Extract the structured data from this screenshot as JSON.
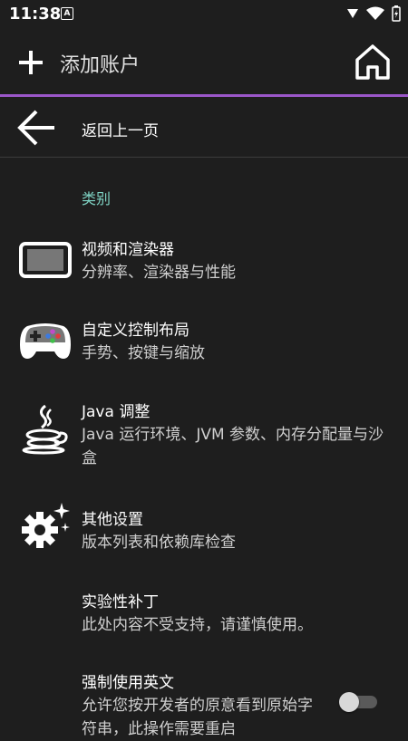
{
  "status_bar": {
    "time": "11:38",
    "notification_badge": "A"
  },
  "app_bar": {
    "title": "添加账户"
  },
  "back": {
    "label": "返回上一页"
  },
  "category": "类别",
  "items": [
    {
      "title": "视频和渲染器",
      "subtitle": "分辨率、渲染器与性能",
      "icon": "display-icon"
    },
    {
      "title": "自定义控制布局",
      "subtitle": "手势、按键与缩放",
      "icon": "gamepad-icon"
    },
    {
      "title": "Java 调整",
      "subtitle": "Java 运行环境、JVM 参数、内存分配量与沙盒",
      "icon": "java-icon"
    },
    {
      "title": "其他设置",
      "subtitle": "版本列表和依赖库检查",
      "icon": "gear-sparkle-icon"
    },
    {
      "title": "实验性补丁",
      "subtitle": "此处内容不受支持，请谨慎使用。",
      "icon": ""
    },
    {
      "title": "强制使用英文",
      "subtitle": "允许您按开发者的原意看到原始字符串，此操作需要重启",
      "icon": ""
    }
  ],
  "force_english_toggle": {
    "on": false
  },
  "colors": {
    "background": "#1e1e1e",
    "accent_line": "#9b57c9",
    "category_text": "#7fd3c4"
  }
}
